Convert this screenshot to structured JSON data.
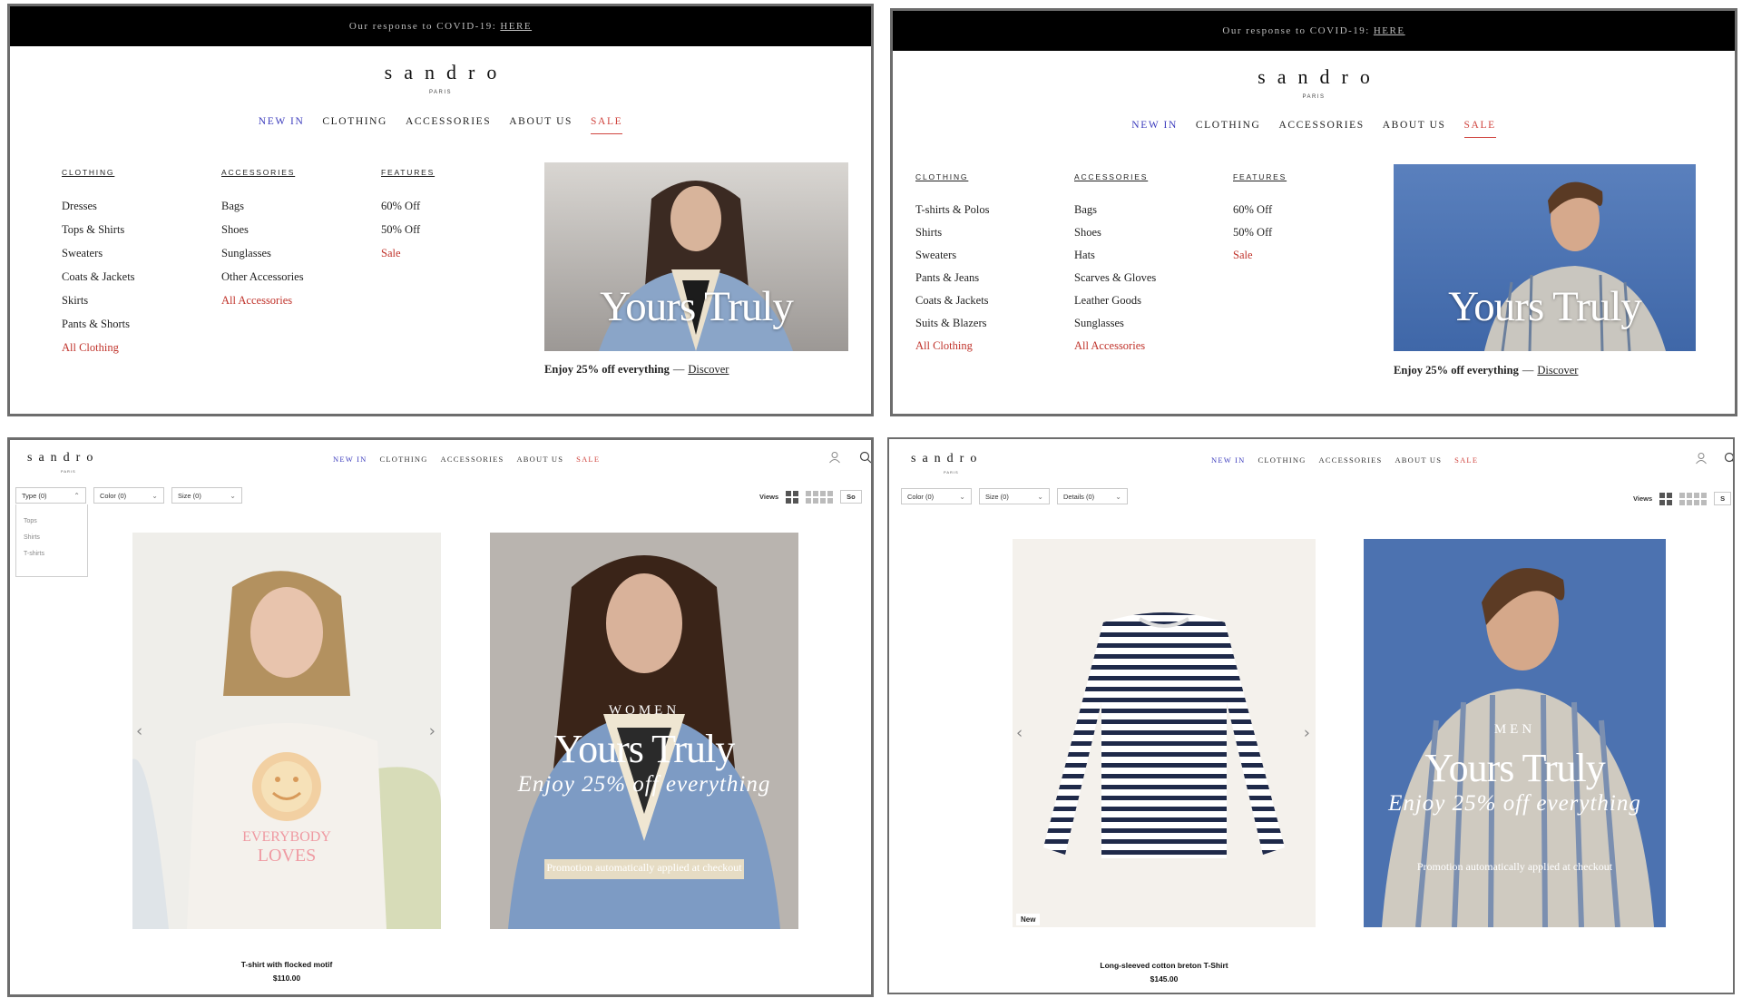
{
  "covid": {
    "text": "Our response to COVID-19:",
    "link": "HERE"
  },
  "brand": {
    "logo": "sandro",
    "city": "PARIS"
  },
  "nav": {
    "new_in": "NEW IN",
    "clothing": "CLOTHING",
    "accessories": "ACCESSORIES",
    "about_us": "ABOUT US",
    "sale": "SALE"
  },
  "women_menu": {
    "clothing_head": "CLOTHING",
    "clothing_items": [
      "Dresses",
      "Tops & Shirts",
      "Sweaters",
      "Coats & Jackets",
      "Skirts",
      "Pants & Shorts"
    ],
    "clothing_all": "All Clothing",
    "accessories_head": "ACCESSORIES",
    "accessories_items": [
      "Bags",
      "Shoes",
      "Sunglasses",
      "Other Accessories"
    ],
    "accessories_all": "All Accessories",
    "features_head": "FEATURES",
    "features_items": [
      "60% Off",
      "50% Off"
    ],
    "features_sale": "Sale"
  },
  "men_menu": {
    "clothing_head": "CLOTHING",
    "clothing_items": [
      "T-shirts & Polos",
      "Shirts",
      "Sweaters",
      "Pants & Jeans",
      "Coats & Jackets",
      "Suits & Blazers"
    ],
    "clothing_all": "All Clothing",
    "accessories_head": "ACCESSORIES",
    "accessories_items": [
      "Bags",
      "Shoes",
      "Hats",
      "Scarves & Gloves",
      "Leather Goods",
      "Sunglasses"
    ],
    "accessories_all": "All Accessories",
    "features_head": "FEATURES",
    "features_items": [
      "60% Off",
      "50% Off"
    ],
    "features_sale": "Sale"
  },
  "promo": {
    "title": "Yours Truly",
    "caption": "Enjoy 25% off everything",
    "dash": "—",
    "discover": "Discover"
  },
  "women_listing": {
    "filters": [
      "Type (0)",
      "Color (0)",
      "Size (0)"
    ],
    "type_options": [
      "Tops",
      "Shirts",
      "T-shirts"
    ],
    "views_label": "Views",
    "sort_label": "So",
    "product_name": "T-shirt with flocked motif",
    "product_price": "$110.00",
    "tee_print_1": "EVERYBODY",
    "tee_print_2": "LOVES",
    "campaign_label": "WOMEN",
    "campaign_title": "Yours Truly",
    "campaign_sub": "Enjoy 25% off everything",
    "campaign_note": "Promotion automatically applied at checkout"
  },
  "men_listing": {
    "filters": [
      "Color (0)",
      "Size (0)",
      "Details (0)"
    ],
    "views_label": "Views",
    "sort_label": "S",
    "product_name": "Long-sleeved cotton breton T-Shirt",
    "product_price": "$145.00",
    "badge": "New",
    "campaign_label": "MEN",
    "campaign_title": "Yours Truly",
    "campaign_sub": "Enjoy 25% off everything",
    "campaign_note": "Promotion automatically applied at checkout"
  },
  "colors": {
    "accent_red": "#c0332b",
    "nav_blue": "#3d3dbd",
    "sale_red": "#d0453f",
    "black_bar": "#000000"
  },
  "icons": {
    "user": "user-icon",
    "search": "search-icon",
    "left": "chevron-left-icon",
    "right": "chevron-right-icon"
  }
}
